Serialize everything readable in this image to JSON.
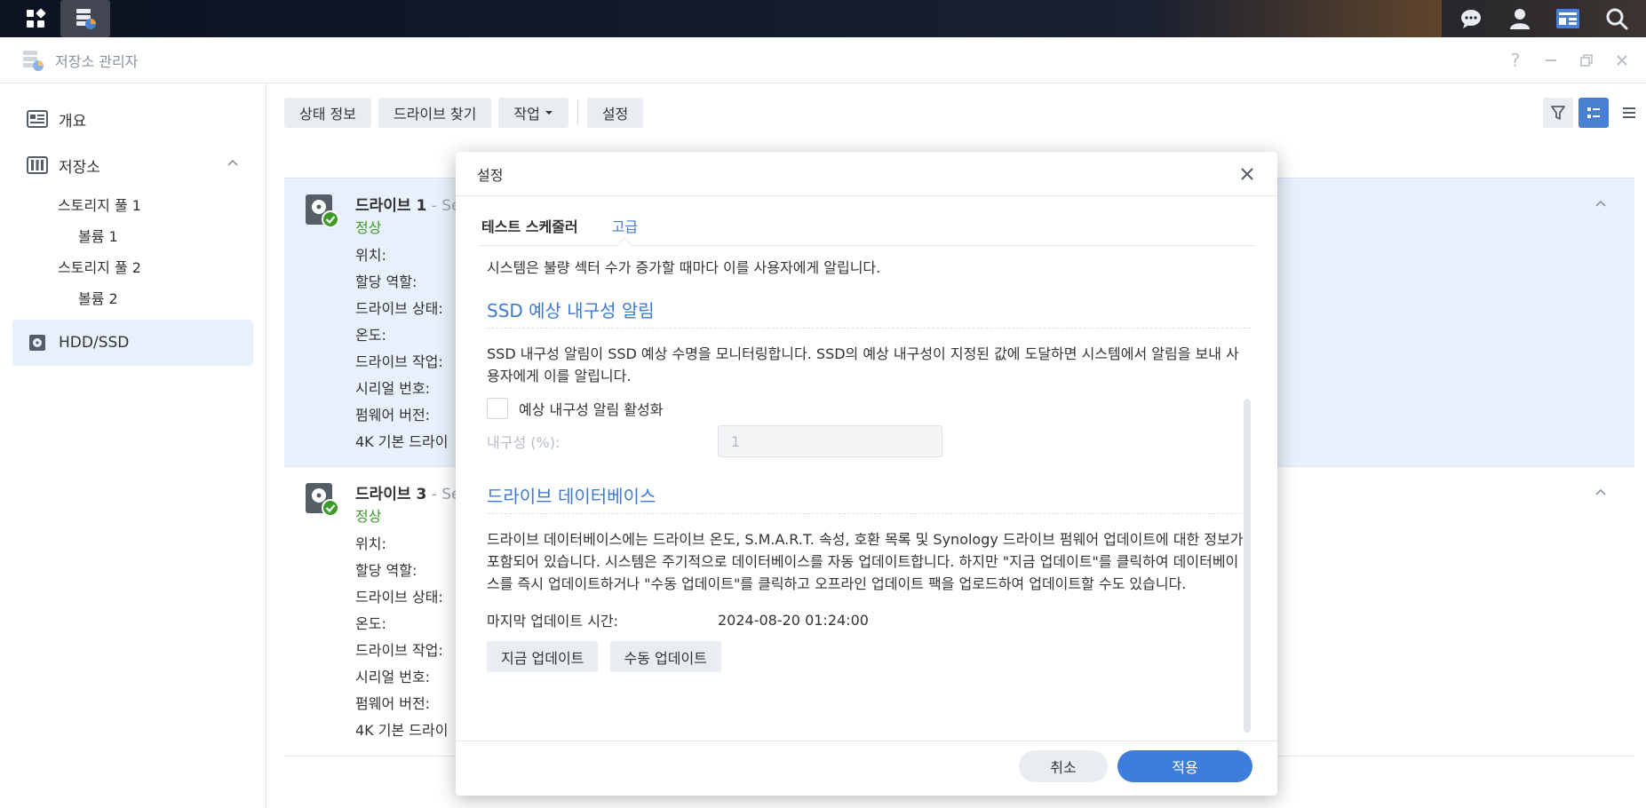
{
  "window": {
    "title": "저장소 관리자"
  },
  "sidebar": {
    "items": [
      {
        "label": "개요",
        "icon": "overview-icon"
      },
      {
        "label": "저장소",
        "icon": "storage-icon"
      },
      {
        "label": "스토리지 풀 1"
      },
      {
        "label": "볼륨 1"
      },
      {
        "label": "스토리지 풀 2"
      },
      {
        "label": "볼륨 2"
      },
      {
        "label": "HDD/SSD",
        "icon": "drive-icon"
      }
    ]
  },
  "toolbar": {
    "status_label": "상태 정보",
    "find_drive_label": "드라이브 찾기",
    "action_label": "작업",
    "settings_label": "설정"
  },
  "drives": [
    {
      "name": "드라이브 1",
      "sub": " - Se",
      "status": "정상",
      "props": [
        "위치:",
        "할당 역할:",
        "드라이브 상태:",
        "온도:",
        "드라이브 작업:",
        "시리얼 번호:",
        "펌웨어 버전:",
        "4K 기본 드라이"
      ]
    },
    {
      "name": "드라이브 3",
      "sub": " - Se",
      "status": "정상",
      "props": [
        "위치:",
        "할당 역할:",
        "드라이브 상태:",
        "온도:",
        "드라이브 작업:",
        "시리얼 번호:",
        "펌웨어 버전:",
        "4K 기본 드라이"
      ]
    }
  ],
  "dialog": {
    "title": "설정",
    "tabs": [
      "테스트 스케줄러",
      "고급"
    ],
    "intro": "시스템은 불량 섹터 수가 증가할 때마다 이를 사용자에게 알립니다.",
    "ssd_section": {
      "title": "SSD 예상 내구성 알림",
      "desc": "SSD 내구성 알림이 SSD 예상 수명을 모니터링합니다. SSD의 예상 내구성이 지정된 값에 도달하면 시스템에서 알림을 보내 사용자에게 이를 알립니다.",
      "checkbox_label": "예상 내구성 알림 활성화",
      "checkbox_checked": false,
      "field_label": "내구성 (%):",
      "field_placeholder": "1"
    },
    "db_section": {
      "title": "드라이브 데이터베이스",
      "desc": "드라이브 데이터베이스에는 드라이브 온도, S.M.A.R.T. 속성, 호환 목록 및 Synology 드라이브 펌웨어 업데이트에 대한 정보가 포함되어 있습니다. 시스템은 주기적으로 데이터베이스를 자동 업데이트합니다. 하지만 \"지금 업데이트\"를 클릭하여 데이터베이스를 즉시 업데이트하거나 \"수동 업데이트\"를 클릭하고 오프라인 업데이트 팩을 업로드하여 업데이트할 수도 있습니다.",
      "last_update_label": "마지막 업데이트 시간:",
      "last_update_value": "2024-08-20 01:24:00",
      "update_now_label": "지금 업데이트",
      "manual_update_label": "수동 업데이트"
    },
    "cancel_label": "취소",
    "apply_label": "적용"
  },
  "colors": {
    "accent": "#3d7bd2",
    "status_ok": "#3f9a2a",
    "selected_row": "#e8f0fb"
  }
}
